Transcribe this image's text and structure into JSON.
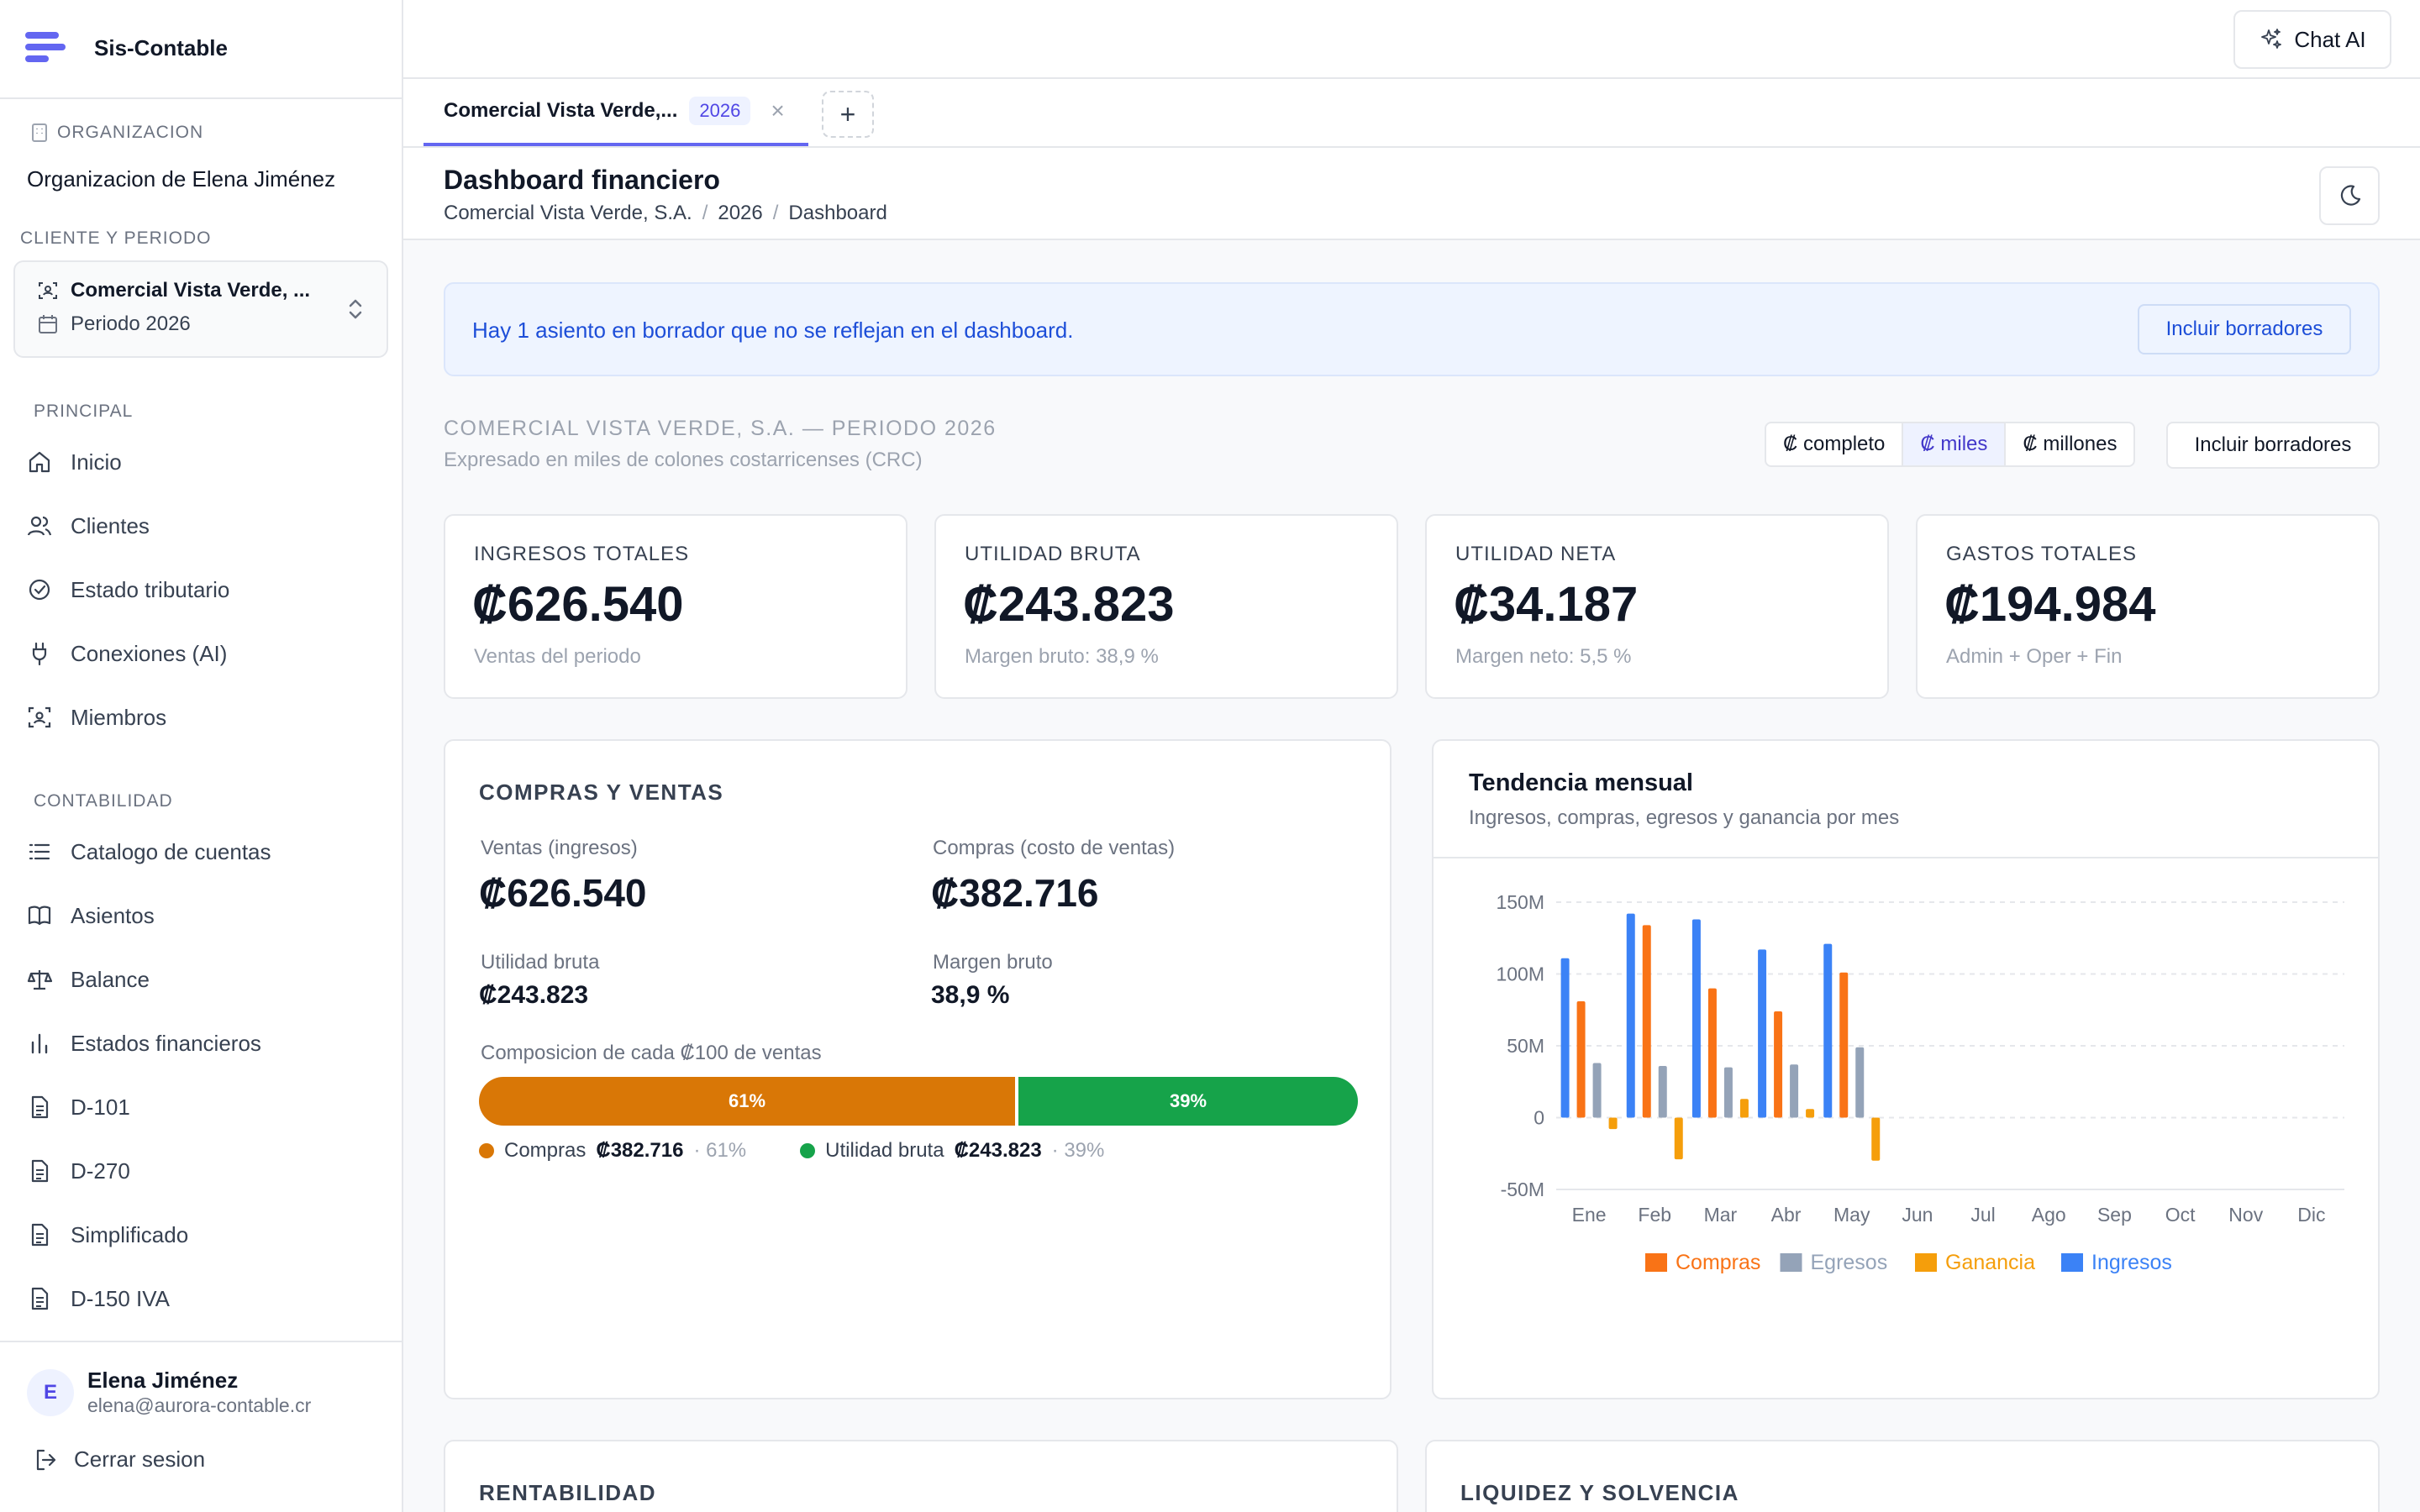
{
  "app": {
    "name": "Sis-Contable"
  },
  "sidebar": {
    "org_label": "ORGANIZACION",
    "org_name": "Organizacion de Elena Jiménez",
    "client_period_label": "CLIENTE Y PERIODO",
    "client_name": "Comercial Vista Verde, ...",
    "period": "Periodo 2026",
    "principal_label": "PRINCIPAL",
    "principal": [
      {
        "label": "Inicio",
        "icon": "home-icon"
      },
      {
        "label": "Clientes",
        "icon": "users-icon"
      },
      {
        "label": "Estado tributario",
        "icon": "check-circle-icon"
      },
      {
        "label": "Conexiones (AI)",
        "icon": "plug-icon"
      },
      {
        "label": "Miembros",
        "icon": "members-icon"
      }
    ],
    "contabilidad_label": "CONTABILIDAD",
    "contabilidad": [
      {
        "label": "Catalogo de cuentas",
        "icon": "list-icon"
      },
      {
        "label": "Asientos",
        "icon": "book-icon"
      },
      {
        "label": "Balance",
        "icon": "scale-icon"
      },
      {
        "label": "Estados financieros",
        "icon": "bar-chart-icon"
      },
      {
        "label": "D-101",
        "icon": "document-icon"
      },
      {
        "label": "D-270",
        "icon": "document-icon"
      },
      {
        "label": "Simplificado",
        "icon": "document-icon"
      },
      {
        "label": "D-150 IVA",
        "icon": "document-icon"
      }
    ],
    "user": {
      "initial": "E",
      "name": "Elena Jiménez",
      "email": "elena@aurora-contable.cr"
    },
    "logout_label": "Cerrar sesion"
  },
  "topbar": {
    "chat_label": "Chat AI"
  },
  "tabs": [
    {
      "title": "Comercial Vista Verde,...",
      "badge": "2026",
      "close": "×"
    }
  ],
  "tab_add": "+",
  "page": {
    "title": "Dashboard financiero",
    "breadcrumb": [
      "Comercial Vista Verde, S.A.",
      "2026",
      "Dashboard"
    ],
    "breadcrumb_sep": "/"
  },
  "alert": {
    "text": "Hay 1 asiento en borrador que no se reflejan en el dashboard.",
    "button": "Incluir borradores"
  },
  "company": {
    "heading": "COMERCIAL VISTA VERDE, S.A. — PERIODO 2026",
    "sub": "Expresado en miles de colones costarricenses (CRC)"
  },
  "units": {
    "options": [
      "₡ completo",
      "₡ miles",
      "₡ millones"
    ],
    "selected": "₡ miles",
    "drafts_button": "Incluir borradores"
  },
  "kpis": [
    {
      "label": "INGRESOS TOTALES",
      "value": "₡626.540",
      "sub": "Ventas del periodo"
    },
    {
      "label": "UTILIDAD BRUTA",
      "value": "₡243.823",
      "sub": "Margen bruto: 38,9 %"
    },
    {
      "label": "UTILIDAD NETA",
      "value": "₡34.187",
      "sub": "Margen neto: 5,5 %"
    },
    {
      "label": "GASTOS TOTALES",
      "value": "₡194.984",
      "sub": "Admin + Oper + Fin"
    }
  ],
  "compras_ventas": {
    "title": "COMPRAS Y VENTAS",
    "ventas_label": "Ventas (ingresos)",
    "ventas_value": "₡626.540",
    "compras_label": "Compras (costo de ventas)",
    "compras_value": "₡382.716",
    "utilidad_label": "Utilidad bruta",
    "utilidad_value": "₡243.823",
    "margen_label": "Margen bruto",
    "margen_value": "38,9 %",
    "composicion_label": "Composicion de cada ₡100 de ventas",
    "compras_share": 0.61,
    "compras_pct": "61%",
    "utilidad_pct": "39%",
    "legend": [
      {
        "name": "Compras",
        "value": "₡382.716",
        "pct": "· 61%",
        "color": "#d97706"
      },
      {
        "name": "Utilidad bruta",
        "value": "₡243.823",
        "pct": "· 39%",
        "color": "#16a34a"
      }
    ]
  },
  "trend": {
    "title": "Tendencia mensual",
    "subtitle": "Ingresos, compras, egresos y ganancia por mes"
  },
  "chart_data": {
    "type": "bar",
    "categories": [
      "Ene",
      "Feb",
      "Mar",
      "Abr",
      "May",
      "Jun",
      "Jul",
      "Ago",
      "Sep",
      "Oct",
      "Nov",
      "Dic"
    ],
    "ylim": [
      -50,
      150
    ],
    "yticks": [
      150,
      100,
      50,
      0,
      -50
    ],
    "ytick_labels": [
      "150M",
      "100M",
      "50M",
      "0",
      "-50M"
    ],
    "grid": true,
    "legend_position": "bottom",
    "series": [
      {
        "name": "Ingresos",
        "color": "#3b82f6",
        "values": [
          111,
          142,
          138,
          117,
          121,
          null,
          null,
          null,
          null,
          null,
          null,
          null
        ]
      },
      {
        "name": "Compras",
        "color": "#f97316",
        "values": [
          81,
          134,
          90,
          74,
          101,
          null,
          null,
          null,
          null,
          null,
          null,
          null
        ]
      },
      {
        "name": "Egresos",
        "color": "#94a3b8",
        "values": [
          38,
          36,
          35,
          37,
          49,
          null,
          null,
          null,
          null,
          null,
          null,
          null
        ]
      },
      {
        "name": "Ganancia",
        "color": "#f59e0b",
        "values": [
          -8,
          -29,
          13,
          6,
          -30,
          null,
          null,
          null,
          null,
          null,
          null,
          null
        ]
      }
    ],
    "legend_order": [
      "Compras",
      "Egresos",
      "Ganancia",
      "Ingresos"
    ]
  },
  "sections": {
    "rentabilidad": "RENTABILIDAD",
    "liquidez": "LIQUIDEZ Y SOLVENCIA"
  }
}
